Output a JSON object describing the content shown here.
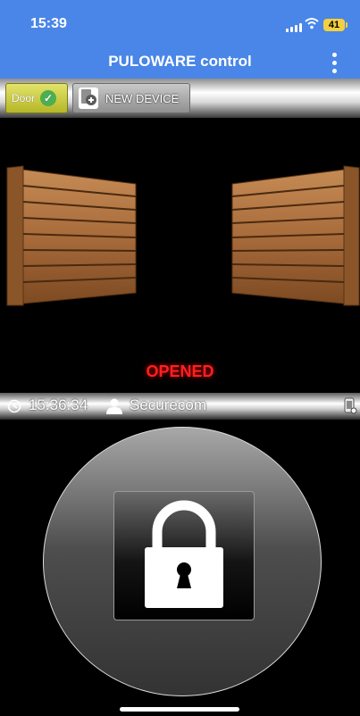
{
  "status_bar": {
    "time": "15:39",
    "battery": "41"
  },
  "app_bar": {
    "title": "PULOWARE control"
  },
  "tabs": {
    "door_label": "Door",
    "new_device_label": "NEW DEVICE"
  },
  "door": {
    "state": "OPENED"
  },
  "info": {
    "time": "15:36:34",
    "user": "Securecom"
  },
  "colors": {
    "app_bar": "#4a86e8",
    "state_text": "#ff2020",
    "door_wood": "#a86b3b",
    "door_tab": "#c9c940"
  },
  "icons": [
    "menu-dots-icon",
    "checkmark-icon",
    "add-device-icon",
    "clock-icon",
    "user-icon",
    "phone-icon",
    "padlock-icon"
  ]
}
